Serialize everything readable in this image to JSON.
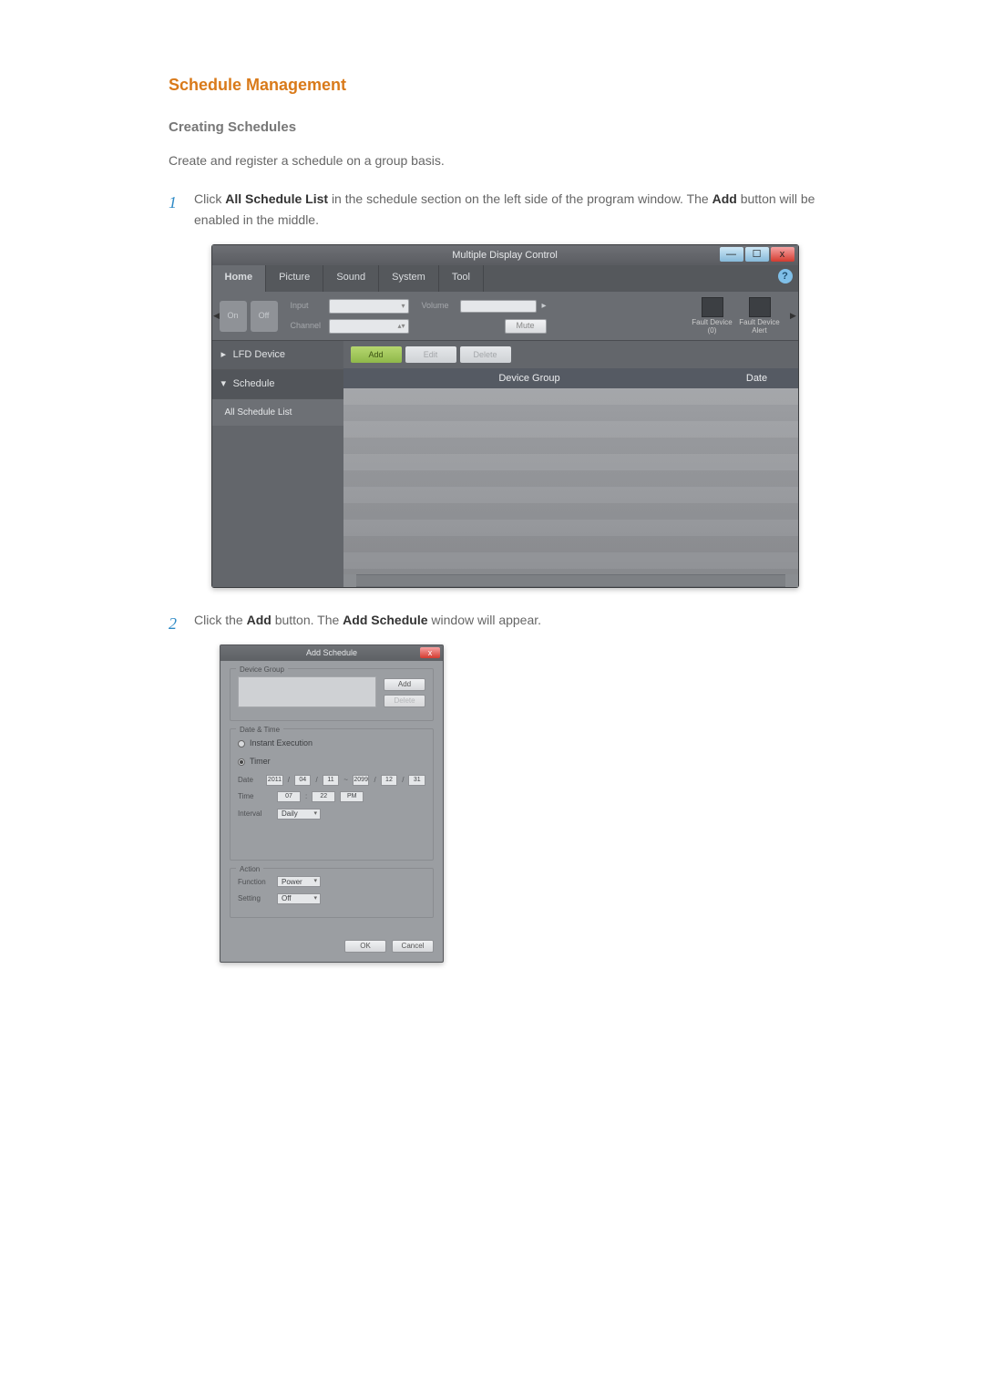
{
  "doc": {
    "heading_main": "Schedule Management",
    "heading_sub": "Creating Schedules",
    "intro": "Create and register a schedule on a group basis.",
    "step1_pre": "Click ",
    "step1_b1": "All Schedule List",
    "step1_mid": " in the schedule section on the left side of the program window. The ",
    "step1_b2": "Add",
    "step1_post": " button will be enabled in the middle.",
    "step2_pre": "Click the ",
    "step2_b1": "Add",
    "step2_mid": " button. The ",
    "step2_b2": "Add Schedule",
    "step2_post": " window will appear."
  },
  "win": {
    "title": "Multiple Display Control",
    "tabs": {
      "home": "Home",
      "picture": "Picture",
      "sound": "Sound",
      "system": "System",
      "tool": "Tool"
    },
    "help_glyph": "?",
    "toolbar": {
      "on": "On",
      "off": "Off",
      "input_label": "Input",
      "channel_label": "Channel",
      "volume_label": "Volume",
      "mute_label": "Mute",
      "fault_device": "Fault Device\n(0)",
      "fault_alert": "Fault Device\nAlert",
      "dd_glyph": "▾",
      "spin_glyph": "▴▾",
      "slider_cap": "▸"
    },
    "sidebar": {
      "lfd": "LFD Device",
      "schedule": "Schedule",
      "all_schedule": "All Schedule List",
      "chev_down": "▾",
      "chev_right": "▸"
    },
    "btns": {
      "add": "Add",
      "edit": "Edit",
      "delete": "Delete"
    },
    "columns": {
      "group": "Device Group",
      "date": "Date"
    },
    "min": "—",
    "max": "☐",
    "close": "x"
  },
  "dlg": {
    "title": "Add Schedule",
    "close": "x",
    "device_group": "Device Group",
    "add": "Add",
    "delete": "Delete",
    "date_time": "Date & Time",
    "instant": "Instant Execution",
    "timer": "Timer",
    "date_label": "Date",
    "time_label": "Time",
    "interval_label": "Interval",
    "date_y1": "2011",
    "date_m1": "04",
    "date_d1": "11",
    "tilde": "~",
    "date_y2": "2099",
    "date_m2": "12",
    "date_d2": "31",
    "time_h": "07",
    "time_m": "22",
    "time_ap": "PM",
    "interval_val": "Daily",
    "action": "Action",
    "function_label": "Function",
    "setting_label": "Setting",
    "function_val": "Power",
    "setting_val": "Off",
    "ok": "OK",
    "cancel": "Cancel",
    "slash": "/",
    "colon": ":"
  }
}
